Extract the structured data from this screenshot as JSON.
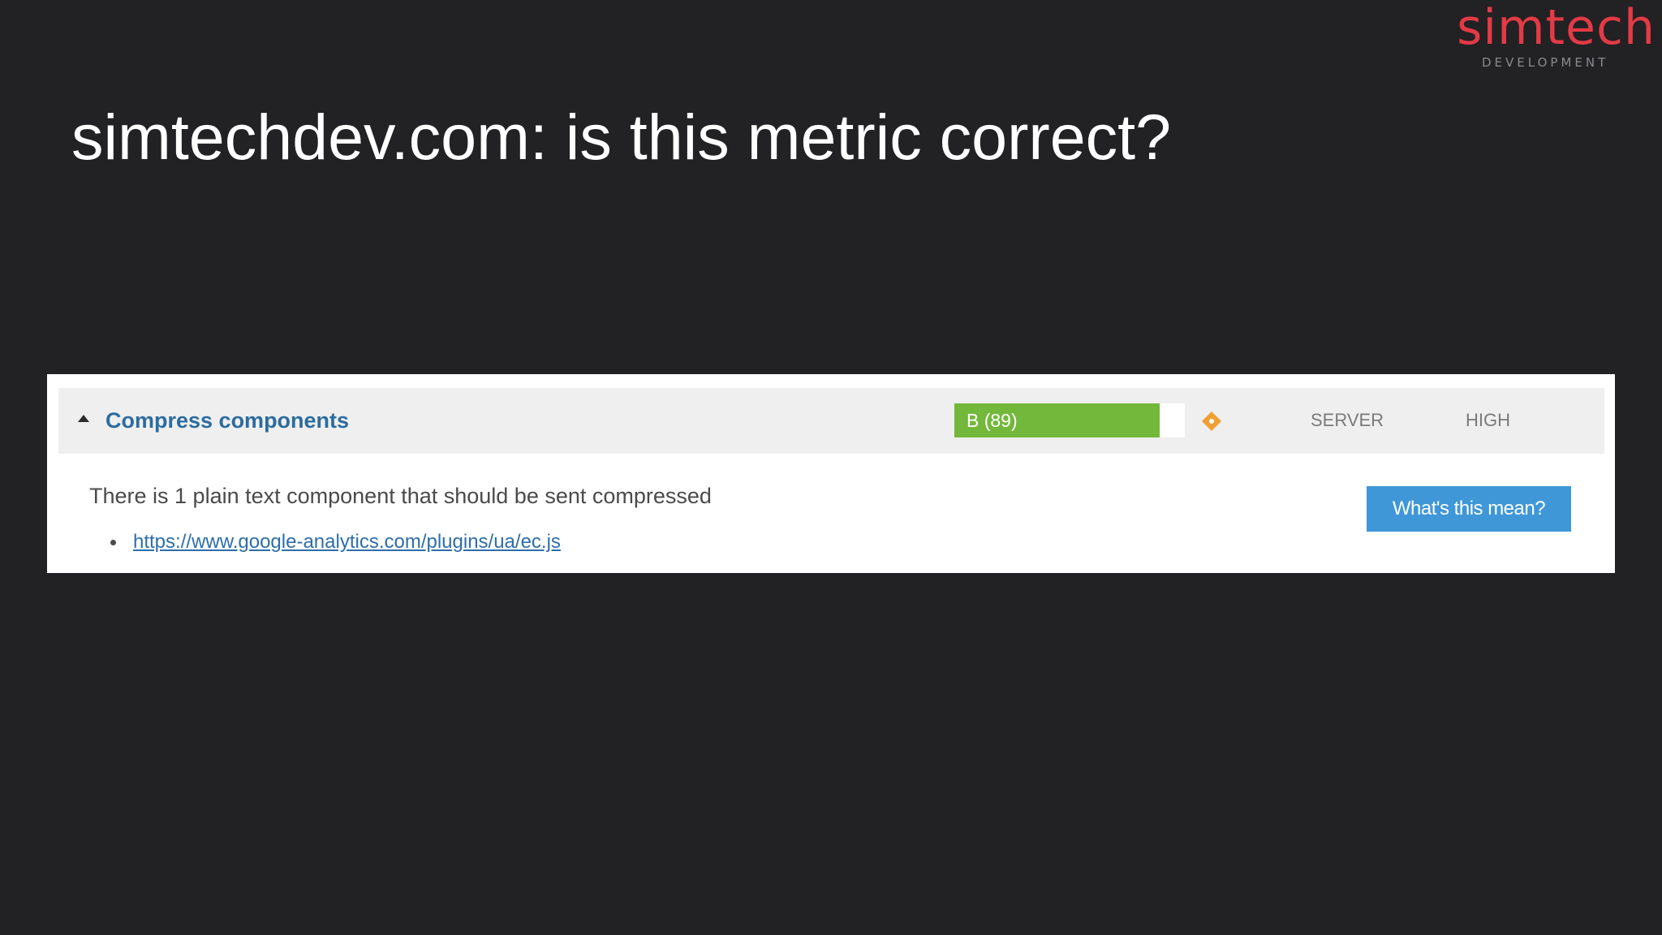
{
  "logo": {
    "wordmark": "simtech",
    "subtitle": "DEVELOPMENT",
    "color": "#e23a46"
  },
  "slide": {
    "title": "simtechdev.com: is this metric correct?"
  },
  "rule": {
    "expand_icon": "caret-up-icon",
    "title": "Compress components",
    "grade_label": "B (89)",
    "grade_score": 89,
    "grade_color": "#73b83b",
    "trend_icon": "diamond-icon",
    "trend_color": "#f0a032",
    "type": "SERVER",
    "priority": "HIGH",
    "message": "There is 1 plain text component that should be sent compressed",
    "resources": [
      "https://www.google-analytics.com/plugins/ua/ec.js"
    ],
    "help_button": "What's this mean?",
    "accent_color": "#3f97d8"
  }
}
